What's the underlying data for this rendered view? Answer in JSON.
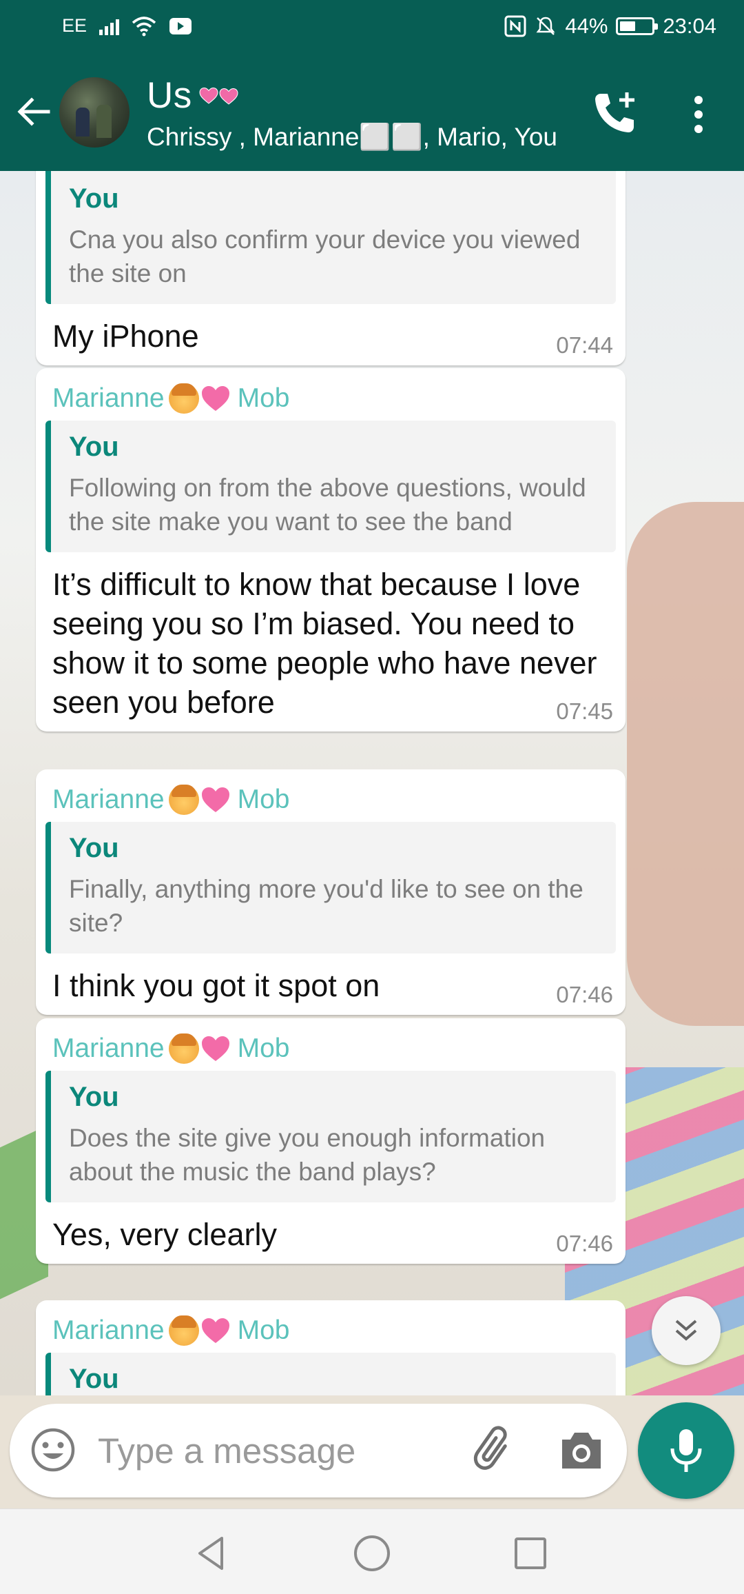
{
  "status_bar": {
    "carrier": "EE",
    "battery_percent": "44%",
    "battery_level": 0.44,
    "time": "23:04",
    "icons": [
      "signal-icon",
      "wifi-icon",
      "video-notification-icon",
      "nfc-icon",
      "mute-icon",
      "battery-icon"
    ]
  },
  "header": {
    "title": "Us",
    "title_emoji": "two-pink-hearts",
    "subtitle": "Chrissy , Marianne⬜⬜, Mario, You"
  },
  "colors": {
    "header_bg": "#075e54",
    "sender_name": "#5bc2bb",
    "quote_border": "#07897c",
    "quote_author": "#0b877a",
    "mic_button": "#128c7e"
  },
  "messages": [
    {
      "sender": "",
      "quote_author": "You",
      "quote_text": "Cna you also confirm your device you viewed the site on",
      "text": "My iPhone",
      "time": "07:44"
    },
    {
      "sender": "Marianne",
      "sender_suffix": "Mob",
      "quote_author": "You",
      "quote_text": "Following on from the above questions, would the site make you want to see the band",
      "text": "It’s difficult to know that because I love seeing you so I’m biased. You need to show it to some people who have never seen you before",
      "time": "07:45"
    },
    {
      "sender": "Marianne",
      "sender_suffix": "Mob",
      "quote_author": "You",
      "quote_text": "Finally, anything more you'd like to see on the site?",
      "text": "I think you got it spot on",
      "time": "07:46"
    },
    {
      "sender": "Marianne",
      "sender_suffix": "Mob",
      "quote_author": "You",
      "quote_text": "Does the site give you enough information about the music the band plays?",
      "text": "Yes, very clearly",
      "time": "07:46"
    },
    {
      "sender": "Marianne",
      "sender_suffix": "Mob",
      "quote_author": "You",
      "quote_text": "",
      "text": "",
      "time": ""
    }
  ],
  "composer": {
    "placeholder": "Type a message"
  }
}
